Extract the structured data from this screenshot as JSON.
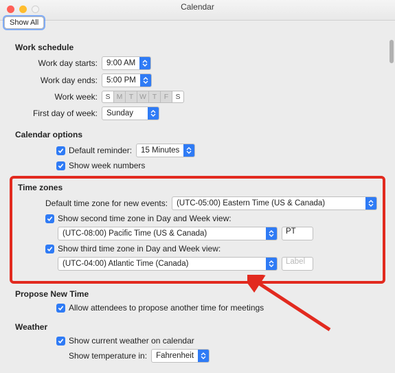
{
  "titlebar": {
    "title": "Calendar",
    "show_all": "Show All"
  },
  "work_schedule": {
    "head": "Work schedule",
    "starts_label": "Work day starts:",
    "starts_value": "9:00 AM",
    "ends_label": "Work day ends:",
    "ends_value": "5:00 PM",
    "week_label": "Work week:",
    "days": [
      "S",
      "M",
      "T",
      "W",
      "T",
      "F",
      "S"
    ],
    "days_on": [
      false,
      true,
      true,
      true,
      true,
      true,
      false
    ],
    "first_day_label": "First day of week:",
    "first_day_value": "Sunday"
  },
  "calendar_options": {
    "head": "Calendar options",
    "default_reminder_label": "Default reminder:",
    "default_reminder_value": "15 Minutes",
    "show_week_numbers": "Show week numbers"
  },
  "time_zones": {
    "head": "Time zones",
    "default_tz_label": "Default time zone for new events:",
    "default_tz_value": "(UTC-05:00) Eastern Time (US & Canada)",
    "second_tz_check": "Show second time zone in Day and Week view:",
    "second_tz_value": "(UTC-08:00) Pacific Time (US & Canada)",
    "second_tz_lbl": "PT",
    "third_tz_check": "Show third time zone in Day and Week view:",
    "third_tz_value": "(UTC-04:00) Atlantic Time (Canada)",
    "third_tz_placeholder": "Label"
  },
  "propose": {
    "head": "Propose New Time",
    "allow_label": "Allow attendees to propose another time for meetings"
  },
  "weather": {
    "head": "Weather",
    "show_label": "Show current weather on calendar",
    "unit_label": "Show temperature in:",
    "unit_value": "Fahrenheit"
  },
  "colors": {
    "accent": "#2f7bf5",
    "highlight": "#e22a1f"
  }
}
